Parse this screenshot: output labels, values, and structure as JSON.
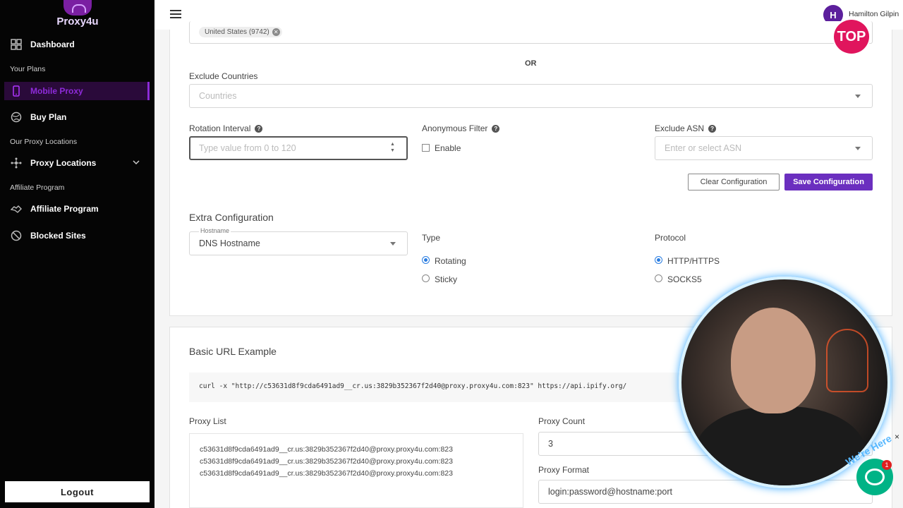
{
  "brand": {
    "name": "Proxy4u"
  },
  "sidebar": {
    "items": [
      {
        "label": "Dashboard"
      },
      {
        "label": "Mobile Proxy"
      },
      {
        "label": "Buy Plan"
      },
      {
        "label": "Proxy Locations"
      },
      {
        "label": "Affiliate Program"
      },
      {
        "label": "Blocked Sites"
      }
    ],
    "sections": {
      "plans": "Your Plans",
      "locations": "Our Proxy Locations",
      "affiliate": "Affiliate Program"
    },
    "logout": "Logout"
  },
  "topbar": {
    "user_initial": "H",
    "user_name": "Hamilton Gilpin",
    "overlay_badge": "TOP"
  },
  "config": {
    "include_chip": "United States (9742)",
    "or_label": "OR",
    "exclude_countries_label": "Exclude Countries",
    "exclude_countries_placeholder": "Countries",
    "rotation_label": "Rotation Interval",
    "rotation_placeholder": "Type value from 0 to 120",
    "anon_label": "Anonymous Filter",
    "anon_option": "Enable",
    "asn_label": "Exclude ASN",
    "asn_placeholder": "Enter or select ASN",
    "clear_button": "Clear Configuration",
    "save_button": "Save Configuration",
    "extra_title": "Extra Configuration",
    "hostname_label": "Hostname",
    "hostname_value": "DNS Hostname",
    "type_label": "Type",
    "type_options": [
      "Rotating",
      "Sticky"
    ],
    "protocol_label": "Protocol",
    "protocol_options": [
      "HTTP/HTTPS",
      "SOCKS5"
    ]
  },
  "example": {
    "title": "Basic URL Example",
    "curl": "curl -x \"http://c53631d8f9cda6491ad9__cr.us:3829b352367f2d40@proxy.proxy4u.com:823\" https://api.ipify.org/",
    "proxy_list_label": "Proxy List",
    "proxy_list": [
      "c53631d8f9cda6491ad9__cr.us:3829b352367f2d40@proxy.proxy4u.com:823",
      "c53631d8f9cda6491ad9__cr.us:3829b352367f2d40@proxy.proxy4u.com:823",
      "c53631d8f9cda6491ad9__cr.us:3829b352367f2d40@proxy.proxy4u.com:823"
    ],
    "proxy_count_label": "Proxy Count",
    "proxy_count": "3",
    "proxy_format_label": "Proxy Format",
    "proxy_format": "login:password@hostname:port"
  },
  "overlay": {
    "chat_badge": "1",
    "close": "×",
    "cam_text": "We're Here"
  }
}
